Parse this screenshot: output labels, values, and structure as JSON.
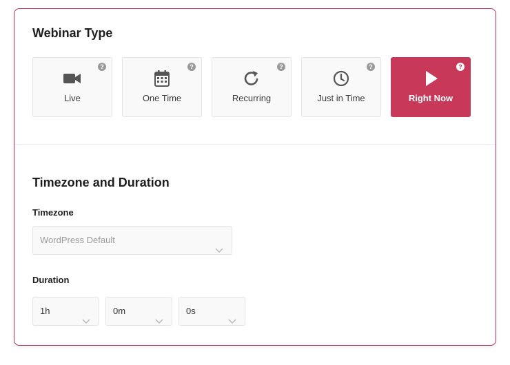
{
  "webinar_type": {
    "title": "Webinar Type",
    "help_glyph": "?",
    "options": [
      {
        "label": "Live",
        "icon": "video-camera-icon",
        "active": false
      },
      {
        "label": "One Time",
        "icon": "calendar-icon",
        "active": false
      },
      {
        "label": "Recurring",
        "icon": "refresh-icon",
        "active": false
      },
      {
        "label": "Just in Time",
        "icon": "clock-icon",
        "active": false
      },
      {
        "label": "Right Now",
        "icon": "play-icon",
        "active": true
      }
    ]
  },
  "timezone_duration": {
    "title": "Timezone and Duration",
    "timezone_label": "Timezone",
    "timezone_value": "WordPress Default",
    "duration_label": "Duration",
    "hours_value": "1h",
    "minutes_value": "0m",
    "seconds_value": "0s"
  },
  "colors": {
    "accent": "#c73859",
    "border_accent": "#b0305a"
  }
}
